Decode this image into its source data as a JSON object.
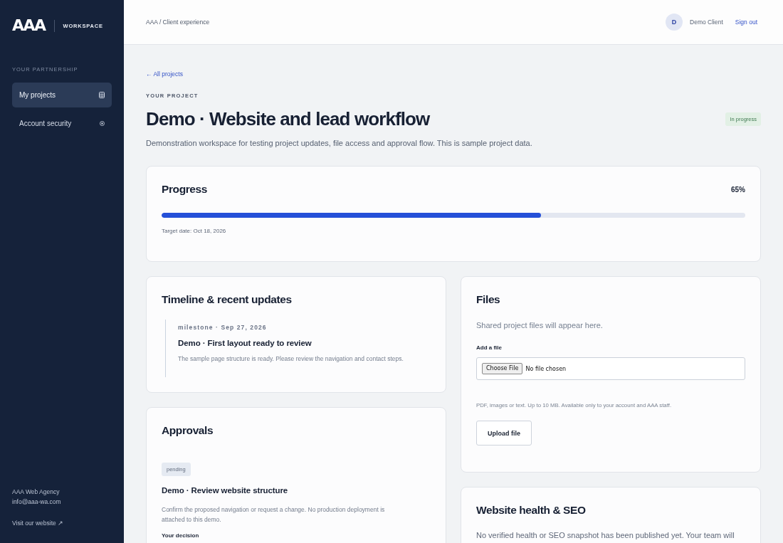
{
  "sidebar": {
    "logo": {
      "mark": "AAA",
      "label": "WORKSPACE"
    },
    "section_label": "YOUR PARTNERSHIP",
    "items": [
      {
        "label": "My projects",
        "kind": "projects",
        "selected": true
      },
      {
        "label": "Account security",
        "kind": "security",
        "selected": false
      }
    ],
    "footer": {
      "agency": "AAA Web Agency",
      "email": "info@aaa-wa.com",
      "link": "Visit our website ↗"
    }
  },
  "header": {
    "breadcrumb": "AAA / Client experience",
    "user": {
      "initial": "D",
      "name": "Demo Client"
    },
    "sign_out": "Sign out"
  },
  "project": {
    "back_link": "← All projects",
    "eyebrow": "YOUR PROJECT",
    "title": "Demo · Website and lead workflow",
    "status": "In progress",
    "description": "Demonstration workspace for testing project updates, file access and approval flow. This is sample project data."
  },
  "progress": {
    "title": "Progress",
    "percent": "65%",
    "level": 0.65,
    "target": "Target date: Oct 18, 2026"
  },
  "timeline": {
    "title": "Timeline & recent updates",
    "items": [
      {
        "meta": "milestone · Sep 27, 2026",
        "title": "Demo · First layout ready to review",
        "body": "The sample page structure is ready. Please review the navigation and contact steps."
      }
    ]
  },
  "approvals": {
    "title": "Approvals",
    "items": [
      {
        "status": "pending",
        "title": "Demo · Review website structure",
        "body": "Confirm the proposed navigation or request a change. No production deployment is attached to this demo.",
        "decision_label": "Your decision"
      }
    ]
  },
  "files": {
    "title": "Files",
    "empty_text": "Shared project files will appear here.",
    "field_label": "Add a file",
    "choose_button": "Choose File",
    "no_file": "No file chosen",
    "hint": "PDF, images or text. Up to 10 MB. Available only to your account and AAA staff.",
    "upload_button": "Upload file"
  },
  "seo": {
    "title": "Website health & SEO",
    "text": "No verified health or SEO snapshot has been published yet. Your team will"
  }
}
